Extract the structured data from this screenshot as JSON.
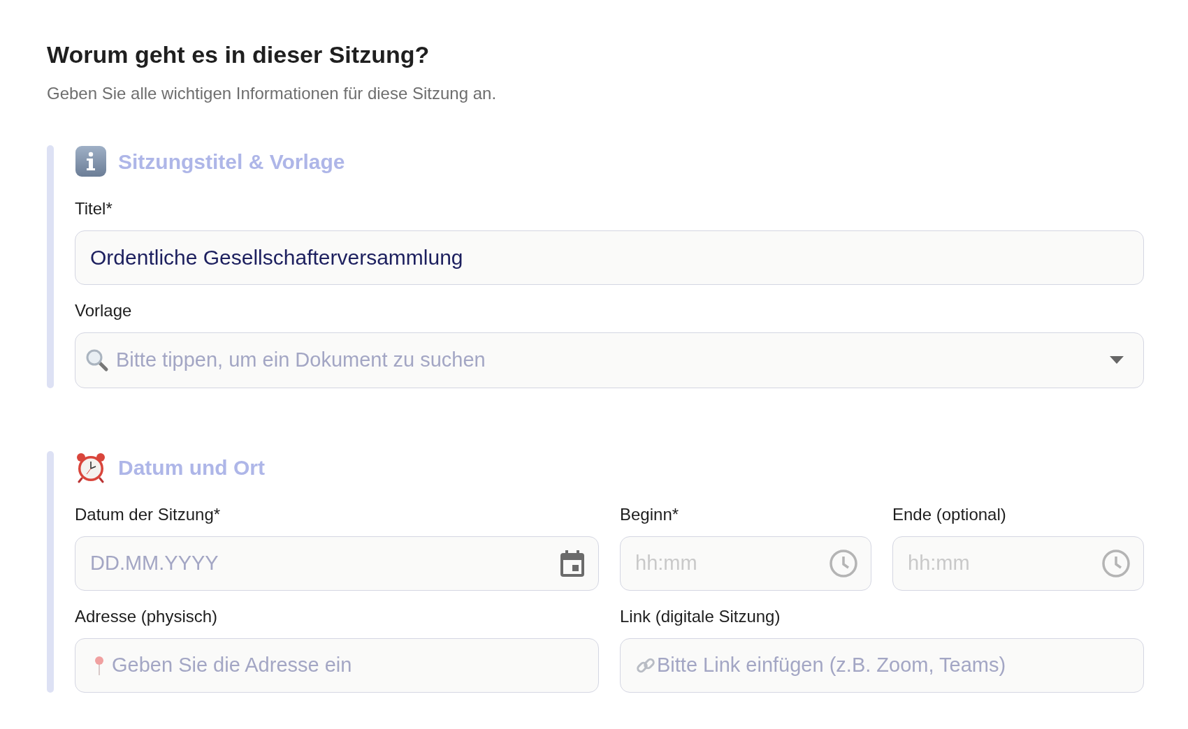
{
  "page": {
    "title": "Worum geht es in dieser Sitzung?",
    "subtitle": "Geben Sie alle wichtigen Informationen für diese Sitzung an."
  },
  "sections": [
    {
      "kind": "info",
      "title": "Sitzungstitel & Vorlage",
      "fields": [
        {
          "kind": "text",
          "label": "Titel*",
          "value": "Ordentliche Gesellschafterversammlung"
        },
        {
          "kind": "select",
          "label": "Vorlage",
          "placeholder": "Bitte tippen, um ein Dokument zu suchen"
        }
      ]
    },
    {
      "kind": "alarm",
      "title": "Datum und Ort",
      "fields": [
        {
          "kind": "date",
          "label": "Datum der Sitzung*",
          "placeholder": "DD.MM.YYYY"
        },
        {
          "kind": "time",
          "label": "Beginn*",
          "placeholder": "hh:mm"
        },
        {
          "kind": "time",
          "label": "Ende (optional)",
          "placeholder": "hh:mm"
        },
        {
          "kind": "address",
          "label": "Adresse (physisch)",
          "placeholder": "Geben Sie die Adresse ein"
        },
        {
          "kind": "link",
          "label": "Link (digitale Sitzung)",
          "placeholder": "Bitte Link einfügen (z.B. Zoom, Teams)"
        }
      ]
    }
  ]
}
